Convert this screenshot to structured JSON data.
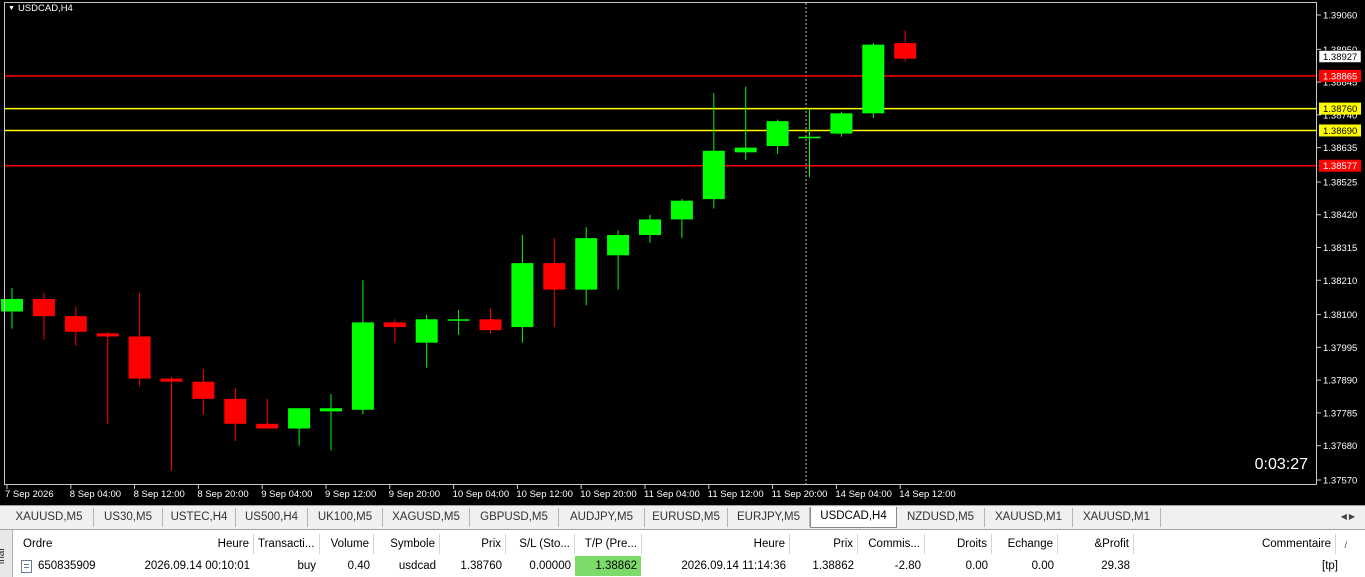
{
  "chart": {
    "symbol_title": "USDCAD,H4",
    "timer": "0:03:27",
    "price_ticks": [
      "1.39060",
      "1.38950",
      "1.38845",
      "1.38740",
      "1.38635",
      "1.38525",
      "1.38420",
      "1.38315",
      "1.38210",
      "1.38100",
      "1.37995",
      "1.37890",
      "1.37785",
      "1.37680",
      "1.37570"
    ],
    "time_ticks": [
      "7 Sep 2026",
      "8 Sep 04:00",
      "8 Sep 12:00",
      "8 Sep 20:00",
      "9 Sep 04:00",
      "9 Sep 12:00",
      "9 Sep 20:00",
      "10 Sep 04:00",
      "10 Sep 12:00",
      "10 Sep 20:00",
      "11 Sep 04:00",
      "11 Sep 12:00",
      "11 Sep 20:00",
      "14 Sep 04:00",
      "14 Sep 12:00"
    ],
    "price_lines": [
      {
        "label": "1.38865",
        "value": 1.38865,
        "color": "#ff0000",
        "label_bg": "#ff0000",
        "label_fg": "#ffffff"
      },
      {
        "label": "1.38760",
        "value": 1.3876,
        "color": "#ffff00",
        "label_bg": "#ffff00",
        "label_fg": "#000000"
      },
      {
        "label": "1.38690",
        "value": 1.3869,
        "color": "#ffff00",
        "label_bg": "#ffff00",
        "label_fg": "#000000"
      },
      {
        "label": "1.38577",
        "value": 1.38577,
        "color": "#ff0000",
        "label_bg": "#ff0000",
        "label_fg": "#ffffff"
      }
    ],
    "current_price": {
      "label": "1.38927",
      "value": 1.38927
    },
    "colors": {
      "bull": "#00ff00",
      "bear": "#ff0000",
      "background": "#000000",
      "axis_text": "#ffffff"
    }
  },
  "chart_data": {
    "type": "candlestick",
    "title": "USDCAD,H4",
    "ylim": [
      1.3757,
      1.3906
    ],
    "candles": [
      {
        "o": 1.3811,
        "h": 1.38185,
        "l": 1.38055,
        "c": 1.3815
      },
      {
        "o": 1.3815,
        "h": 1.3817,
        "l": 1.3802,
        "c": 1.38095
      },
      {
        "o": 1.38095,
        "h": 1.38125,
        "l": 1.38,
        "c": 1.38045
      },
      {
        "o": 1.3804,
        "h": 1.38045,
        "l": 1.3775,
        "c": 1.3803
      },
      {
        "o": 1.3803,
        "h": 1.3817,
        "l": 1.3787,
        "c": 1.37895
      },
      {
        "o": 1.37895,
        "h": 1.379,
        "l": 1.376,
        "c": 1.37885
      },
      {
        "o": 1.37885,
        "h": 1.37925,
        "l": 1.3778,
        "c": 1.3783
      },
      {
        "o": 1.3783,
        "h": 1.37865,
        "l": 1.37695,
        "c": 1.3775
      },
      {
        "o": 1.3775,
        "h": 1.3783,
        "l": 1.37735,
        "c": 1.37735
      },
      {
        "o": 1.37735,
        "h": 1.378,
        "l": 1.3768,
        "c": 1.378
      },
      {
        "o": 1.3779,
        "h": 1.37845,
        "l": 1.37665,
        "c": 1.378
      },
      {
        "o": 1.37795,
        "h": 1.3821,
        "l": 1.3778,
        "c": 1.38075
      },
      {
        "o": 1.38075,
        "h": 1.38085,
        "l": 1.3801,
        "c": 1.3806
      },
      {
        "o": 1.3801,
        "h": 1.381,
        "l": 1.3793,
        "c": 1.38085
      },
      {
        "o": 1.38085,
        "h": 1.38115,
        "l": 1.38035,
        "c": 1.38085
      },
      {
        "o": 1.38085,
        "h": 1.3812,
        "l": 1.3804,
        "c": 1.3805
      },
      {
        "o": 1.3806,
        "h": 1.38355,
        "l": 1.3801,
        "c": 1.38265
      },
      {
        "o": 1.38265,
        "h": 1.38345,
        "l": 1.3806,
        "c": 1.3818
      },
      {
        "o": 1.3818,
        "h": 1.3838,
        "l": 1.3813,
        "c": 1.38345
      },
      {
        "o": 1.3829,
        "h": 1.3837,
        "l": 1.3818,
        "c": 1.38355
      },
      {
        "o": 1.38355,
        "h": 1.3842,
        "l": 1.3833,
        "c": 1.38405
      },
      {
        "o": 1.38405,
        "h": 1.3847,
        "l": 1.38345,
        "c": 1.38465
      },
      {
        "o": 1.3847,
        "h": 1.3881,
        "l": 1.3844,
        "c": 1.38625
      },
      {
        "o": 1.3862,
        "h": 1.3883,
        "l": 1.38595,
        "c": 1.38635
      },
      {
        "o": 1.3864,
        "h": 1.38725,
        "l": 1.38615,
        "c": 1.3872
      },
      {
        "o": 1.38665,
        "h": 1.3876,
        "l": 1.3854,
        "c": 1.3867
      },
      {
        "o": 1.3868,
        "h": 1.3875,
        "l": 1.3867,
        "c": 1.38745
      },
      {
        "o": 1.38745,
        "h": 1.3897,
        "l": 1.3873,
        "c": 1.38965
      },
      {
        "o": 1.3897,
        "h": 1.3901,
        "l": 1.3891,
        "c": 1.3892
      }
    ]
  },
  "tabs": {
    "items": [
      {
        "label": "XAUUSD,M5",
        "active": false
      },
      {
        "label": "US30,M5",
        "active": false
      },
      {
        "label": "USTEC,H4",
        "active": false
      },
      {
        "label": "US500,H4",
        "active": false
      },
      {
        "label": "UK100,M5",
        "active": false
      },
      {
        "label": "XAGUSD,M5",
        "active": false
      },
      {
        "label": "GBPUSD,M5",
        "active": false
      },
      {
        "label": "AUDJPY,M5",
        "active": false
      },
      {
        "label": "EURUSD,M5",
        "active": false
      },
      {
        "label": "EURJPY,M5",
        "active": false
      },
      {
        "label": "USDCAD,H4",
        "active": true
      },
      {
        "label": "NZDUSD,M5",
        "active": false
      },
      {
        "label": "XAUUSD,M1",
        "active": false
      },
      {
        "label": "XAUUSD,M1",
        "active": false
      }
    ]
  },
  "terminal": {
    "side_label": "inal",
    "headers": [
      "Ordre",
      "Heure",
      "Transacti...",
      "Volume",
      "Symbole",
      "Prix",
      "S/L (Sto...",
      "T/P (Pre...",
      "Heure",
      "Prix",
      "Commis...",
      "Droits",
      "Echange",
      "&Profit",
      "Commentaire"
    ],
    "row": [
      "650835909",
      "2026.09.14 00:10:01",
      "buy",
      "0.40",
      "usdcad",
      "1.38760",
      "0.00000",
      "1.38862",
      "2026.09.14 11:14:36",
      "1.38862",
      "-2.80",
      "0.00",
      "0.00",
      "29.38",
      "[tp]"
    ],
    "sort_arrow": "/"
  }
}
